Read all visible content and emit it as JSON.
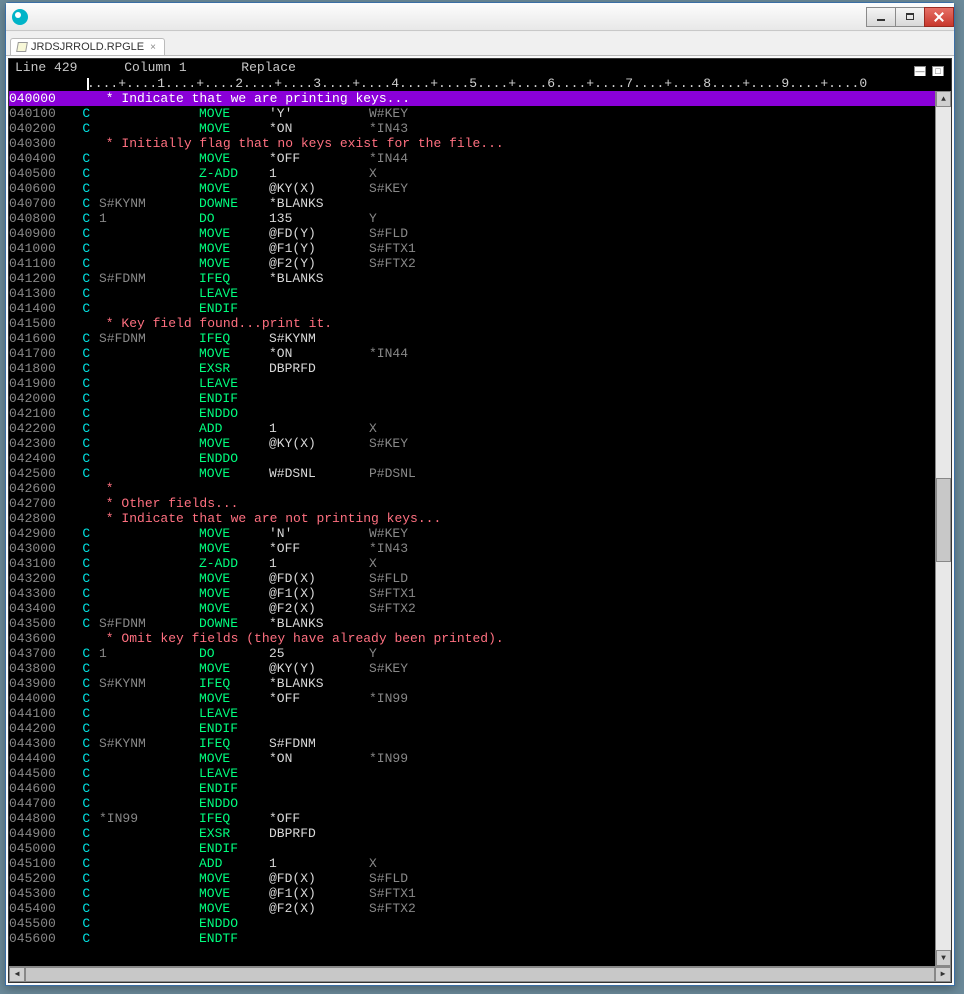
{
  "tab": {
    "filename": "JRDSJRROLD.RPGLE",
    "close": "×"
  },
  "status": {
    "line_label": "Line",
    "line": "429",
    "col_label": "Column",
    "col": "1",
    "mode": "Replace"
  },
  "ruler": "....+....1....+....2....+....3....+....4....+....5....+....6....+....7....+....8....+....9....+....0",
  "lines": [
    {
      "seq": "040000",
      "type": "cmt",
      "hl": true,
      "text": "      * Indicate that we are printing keys..."
    },
    {
      "seq": "040100",
      "c": "C",
      "f1": "",
      "op": "MOVE",
      "p1": "'Y'",
      "p2": "W#KEY"
    },
    {
      "seq": "040200",
      "c": "C",
      "f1": "",
      "op": "MOVE",
      "p1": "*ON",
      "p2": "*IN43"
    },
    {
      "seq": "040300",
      "type": "cmt",
      "text": "      * Initially flag that no keys exist for the file..."
    },
    {
      "seq": "040400",
      "c": "C",
      "f1": "",
      "op": "MOVE",
      "p1": "*OFF",
      "p2": "*IN44"
    },
    {
      "seq": "040500",
      "c": "C",
      "f1": "",
      "op": "Z-ADD",
      "p1": "1",
      "p2": "X"
    },
    {
      "seq": "040600",
      "c": "C",
      "f1": "",
      "op": "MOVE",
      "p1": "@KY(X)",
      "p2": "S#KEY"
    },
    {
      "seq": "040700",
      "c": "C",
      "f1": "S#KYNM",
      "op": "DOWNE",
      "p1": "*BLANKS",
      "p2": ""
    },
    {
      "seq": "040800",
      "c": "C",
      "f1": "1",
      "op": "DO",
      "p1": "135",
      "p2": "Y"
    },
    {
      "seq": "040900",
      "c": "C",
      "f1": "",
      "op": "MOVE",
      "p1": "@FD(Y)",
      "p2": "S#FLD"
    },
    {
      "seq": "041000",
      "c": "C",
      "f1": "",
      "op": "MOVE",
      "p1": "@F1(Y)",
      "p2": "S#FTX1"
    },
    {
      "seq": "041100",
      "c": "C",
      "f1": "",
      "op": "MOVE",
      "p1": "@F2(Y)",
      "p2": "S#FTX2"
    },
    {
      "seq": "041200",
      "c": "C",
      "f1": "S#FDNM",
      "op": "IFEQ",
      "p1": "*BLANKS",
      "p2": ""
    },
    {
      "seq": "041300",
      "c": "C",
      "f1": "",
      "op": "LEAVE",
      "p1": "",
      "p2": ""
    },
    {
      "seq": "041400",
      "c": "C",
      "f1": "",
      "op": "ENDIF",
      "p1": "",
      "p2": ""
    },
    {
      "seq": "041500",
      "type": "cmt",
      "text": "      * Key field found...print it."
    },
    {
      "seq": "041600",
      "c": "C",
      "f1": "S#FDNM",
      "op": "IFEQ",
      "p1": "S#KYNM",
      "p2": ""
    },
    {
      "seq": "041700",
      "c": "C",
      "f1": "",
      "op": "MOVE",
      "p1": "*ON",
      "p2": "*IN44"
    },
    {
      "seq": "041800",
      "c": "C",
      "f1": "",
      "op": "EXSR",
      "p1": "DBPRFD",
      "p2": ""
    },
    {
      "seq": "041900",
      "c": "C",
      "f1": "",
      "op": "LEAVE",
      "p1": "",
      "p2": ""
    },
    {
      "seq": "042000",
      "c": "C",
      "f1": "",
      "op": "ENDIF",
      "p1": "",
      "p2": ""
    },
    {
      "seq": "042100",
      "c": "C",
      "f1": "",
      "op": "ENDDO",
      "p1": "",
      "p2": ""
    },
    {
      "seq": "042200",
      "c": "C",
      "f1": "",
      "op": "ADD",
      "p1": "1",
      "p2": "X"
    },
    {
      "seq": "042300",
      "c": "C",
      "f1": "",
      "op": "MOVE",
      "p1": "@KY(X)",
      "p2": "S#KEY"
    },
    {
      "seq": "042400",
      "c": "C",
      "f1": "",
      "op": "ENDDO",
      "p1": "",
      "p2": ""
    },
    {
      "seq": "042500",
      "c": "C",
      "f1": "",
      "op": "MOVE",
      "p1": "W#DSNL",
      "p2": "P#DSNL"
    },
    {
      "seq": "042600",
      "type": "cmt",
      "text": "      *"
    },
    {
      "seq": "042700",
      "type": "cmt",
      "text": "      * Other fields..."
    },
    {
      "seq": "042800",
      "type": "cmt",
      "text": "      * Indicate that we are not printing keys..."
    },
    {
      "seq": "042900",
      "c": "C",
      "f1": "",
      "op": "MOVE",
      "p1": "'N'",
      "p2": "W#KEY"
    },
    {
      "seq": "043000",
      "c": "C",
      "f1": "",
      "op": "MOVE",
      "p1": "*OFF",
      "p2": "*IN43"
    },
    {
      "seq": "043100",
      "c": "C",
      "f1": "",
      "op": "Z-ADD",
      "p1": "1",
      "p2": "X"
    },
    {
      "seq": "043200",
      "c": "C",
      "f1": "",
      "op": "MOVE",
      "p1": "@FD(X)",
      "p2": "S#FLD"
    },
    {
      "seq": "043300",
      "c": "C",
      "f1": "",
      "op": "MOVE",
      "p1": "@F1(X)",
      "p2": "S#FTX1"
    },
    {
      "seq": "043400",
      "c": "C",
      "f1": "",
      "op": "MOVE",
      "p1": "@F2(X)",
      "p2": "S#FTX2"
    },
    {
      "seq": "043500",
      "c": "C",
      "f1": "S#FDNM",
      "op": "DOWNE",
      "p1": "*BLANKS",
      "p2": ""
    },
    {
      "seq": "043600",
      "type": "cmt",
      "text": "      * Omit key fields (they have already been printed)."
    },
    {
      "seq": "043700",
      "c": "C",
      "f1": "1",
      "op": "DO",
      "p1": "25",
      "p2": "Y"
    },
    {
      "seq": "043800",
      "c": "C",
      "f1": "",
      "op": "MOVE",
      "p1": "@KY(Y)",
      "p2": "S#KEY"
    },
    {
      "seq": "043900",
      "c": "C",
      "f1": "S#KYNM",
      "op": "IFEQ",
      "p1": "*BLANKS",
      "p2": ""
    },
    {
      "seq": "044000",
      "c": "C",
      "f1": "",
      "op": "MOVE",
      "p1": "*OFF",
      "p2": "*IN99"
    },
    {
      "seq": "044100",
      "c": "C",
      "f1": "",
      "op": "LEAVE",
      "p1": "",
      "p2": ""
    },
    {
      "seq": "044200",
      "c": "C",
      "f1": "",
      "op": "ENDIF",
      "p1": "",
      "p2": ""
    },
    {
      "seq": "044300",
      "c": "C",
      "f1": "S#KYNM",
      "op": "IFEQ",
      "p1": "S#FDNM",
      "p2": ""
    },
    {
      "seq": "044400",
      "c": "C",
      "f1": "",
      "op": "MOVE",
      "p1": "*ON",
      "p2": "*IN99"
    },
    {
      "seq": "044500",
      "c": "C",
      "f1": "",
      "op": "LEAVE",
      "p1": "",
      "p2": ""
    },
    {
      "seq": "044600",
      "c": "C",
      "f1": "",
      "op": "ENDIF",
      "p1": "",
      "p2": ""
    },
    {
      "seq": "044700",
      "c": "C",
      "f1": "",
      "op": "ENDDO",
      "p1": "",
      "p2": ""
    },
    {
      "seq": "044800",
      "c": "C",
      "f1": "*IN99",
      "op": "IFEQ",
      "p1": "*OFF",
      "p2": ""
    },
    {
      "seq": "044900",
      "c": "C",
      "f1": "",
      "op": "EXSR",
      "p1": "DBPRFD",
      "p2": ""
    },
    {
      "seq": "045000",
      "c": "C",
      "f1": "",
      "op": "ENDIF",
      "p1": "",
      "p2": ""
    },
    {
      "seq": "045100",
      "c": "C",
      "f1": "",
      "op": "ADD",
      "p1": "1",
      "p2": "X"
    },
    {
      "seq": "045200",
      "c": "C",
      "f1": "",
      "op": "MOVE",
      "p1": "@FD(X)",
      "p2": "S#FLD"
    },
    {
      "seq": "045300",
      "c": "C",
      "f1": "",
      "op": "MOVE",
      "p1": "@F1(X)",
      "p2": "S#FTX1"
    },
    {
      "seq": "045400",
      "c": "C",
      "f1": "",
      "op": "MOVE",
      "p1": "@F2(X)",
      "p2": "S#FTX2"
    },
    {
      "seq": "045500",
      "c": "C",
      "f1": "",
      "op": "ENDDO",
      "p1": "",
      "p2": ""
    },
    {
      "seq": "045600",
      "c": "C",
      "f1": "",
      "op": "ENDTF",
      "p1": "",
      "p2": ""
    }
  ]
}
